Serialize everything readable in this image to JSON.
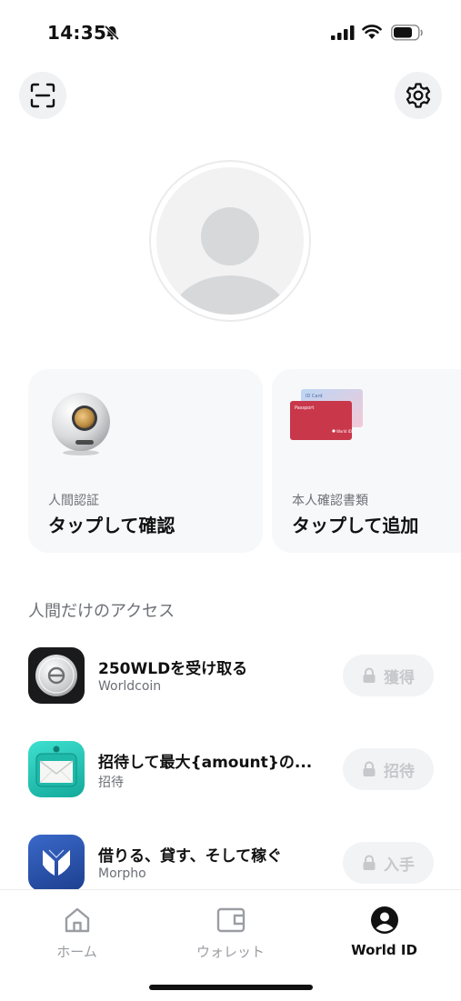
{
  "status_bar": {
    "time": "14:35"
  },
  "header": {
    "scan_icon": "scan-icon",
    "settings_icon": "gear-icon"
  },
  "cards": [
    {
      "subtitle": "人間認証",
      "title": "タップして確認"
    },
    {
      "subtitle": "本人確認書類",
      "title": "タップして追加",
      "passport_label": "Passport",
      "id_label": "ID Card",
      "brand": "World ID"
    }
  ],
  "section": {
    "title": "人間だけのアクセス"
  },
  "rows": [
    {
      "title": "250WLDを受け取る",
      "subtitle": "Worldcoin",
      "action": "獲得"
    },
    {
      "title": "招待して最大{amount}の...",
      "subtitle": "招待",
      "action": "招待"
    },
    {
      "title": "借りる、貸す、そして稼ぐ",
      "subtitle": "Morpho",
      "action": "入手"
    }
  ],
  "tabs": [
    {
      "label": "ホーム",
      "icon": "home-icon"
    },
    {
      "label": "ウォレット",
      "icon": "wallet-icon"
    },
    {
      "label": "World ID",
      "icon": "world-id-icon"
    }
  ],
  "colors": {
    "accent": "#111111",
    "card_bg": "#f7f8fa",
    "muted": "#6c6f75",
    "disabled": "#c6c8cc"
  }
}
